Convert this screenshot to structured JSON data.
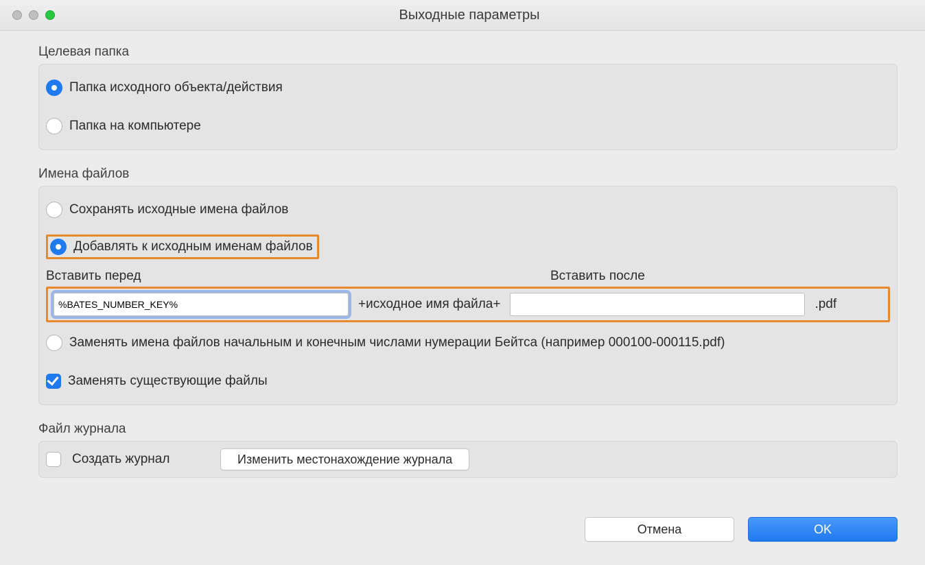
{
  "window": {
    "title": "Выходные параметры"
  },
  "target_folder": {
    "section_label": "Целевая папка",
    "opt_source": "Папка исходного объекта/действия",
    "opt_computer": "Папка на компьютере"
  },
  "filenames": {
    "section_label": "Имена файлов",
    "opt_keep": "Сохранять исходные имена файлов",
    "opt_append": "Добавлять к исходным именам файлов",
    "label_before": "Вставить перед",
    "label_after": "Вставить после",
    "value_before": "%BATES_NUMBER_KEY%",
    "value_after": "",
    "middle_text": "+исходное имя файла+",
    "ext": ".pdf",
    "opt_replace_bates": "Заменять имена файлов начальным и конечным числами нумерации Бейтса (например 000100-000115.pdf)",
    "chk_overwrite": "Заменять существующие файлы"
  },
  "log_file": {
    "section_label": "Файл журнала",
    "chk_create": "Создать журнал",
    "btn_change": "Изменить местонахождение журнала"
  },
  "footer": {
    "cancel": "Отмена",
    "ok": "OK"
  }
}
